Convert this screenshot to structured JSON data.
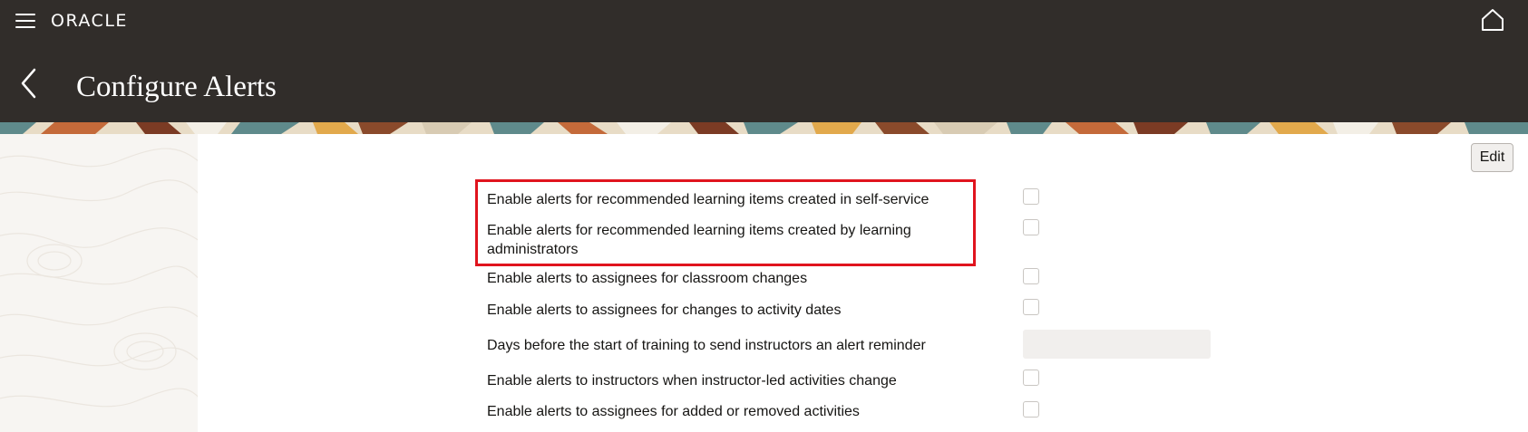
{
  "header": {
    "brand": "ORACLE",
    "page_title": "Configure Alerts"
  },
  "toolbar": {
    "edit_label": "Edit"
  },
  "settings": [
    {
      "label": "Enable alerts for recommended learning items created in self-service",
      "type": "checkbox",
      "checked": false
    },
    {
      "label": "Enable alerts for recommended learning items created by learning administrators",
      "type": "checkbox",
      "checked": false
    },
    {
      "label": "Enable alerts to assignees for classroom changes",
      "type": "checkbox",
      "checked": false
    },
    {
      "label": "Enable alerts to assignees for changes to activity dates",
      "type": "checkbox",
      "checked": false
    },
    {
      "label": "Days before the start of training to send instructors an alert reminder",
      "type": "number",
      "value": ""
    },
    {
      "label": "Enable alerts to instructors when instructor-led activities change",
      "type": "checkbox",
      "checked": false
    },
    {
      "label": "Enable alerts to assignees for added or removed activities",
      "type": "checkbox",
      "checked": false
    }
  ],
  "icons": {
    "menu": "hamburger-menu-icon",
    "home": "home-icon",
    "back": "chevron-left-icon"
  },
  "colors": {
    "header_bg": "#312d2a",
    "highlight_border": "#e0141e",
    "left_panel_bg": "#f7f5f2",
    "input_bg": "#f1efed"
  }
}
